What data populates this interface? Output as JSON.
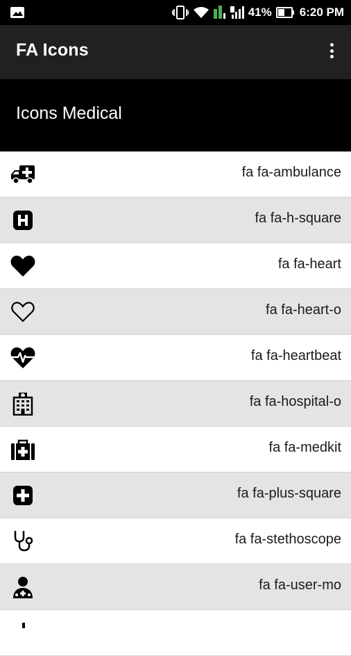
{
  "status_bar": {
    "battery": "41%",
    "time": "6:20 PM",
    "icons": [
      "gallery-icon",
      "vibrate-icon",
      "wifi-icon",
      "signal-icon",
      "battery-icon"
    ]
  },
  "app_bar": {
    "title": "FA Icons"
  },
  "section": {
    "title": "Icons Medical"
  },
  "list": [
    {
      "label": "fa fa-ambulance",
      "icon": "ambulance-icon"
    },
    {
      "label": "fa fa-h-square",
      "icon": "h-square-icon"
    },
    {
      "label": "fa fa-heart",
      "icon": "heart-icon"
    },
    {
      "label": "fa fa-heart-o",
      "icon": "heart-outline-icon"
    },
    {
      "label": "fa fa-heartbeat",
      "icon": "heartbeat-icon"
    },
    {
      "label": "fa fa-hospital-o",
      "icon": "hospital-icon"
    },
    {
      "label": "fa fa-medkit",
      "icon": "medkit-icon"
    },
    {
      "label": "fa fa-plus-square",
      "icon": "plus-square-icon"
    },
    {
      "label": "fa fa-stethoscope",
      "icon": "stethoscope-icon"
    },
    {
      "label": "fa fa-user-mo",
      "icon": "user-md-icon"
    }
  ]
}
